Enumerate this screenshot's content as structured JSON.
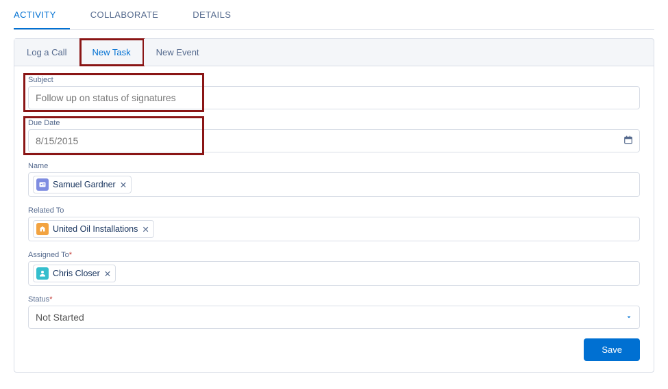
{
  "mainTabs": {
    "activity": "ACTIVITY",
    "collaborate": "COLLABORATE",
    "details": "DETAILS"
  },
  "subTabs": {
    "logACall": "Log a Call",
    "newTask": "New Task",
    "newEvent": "New Event"
  },
  "form": {
    "subject": {
      "label": "Subject",
      "value": "Follow up on status of signatures"
    },
    "dueDate": {
      "label": "Due Date",
      "value": "8/15/2015"
    },
    "name": {
      "label": "Name",
      "pill": "Samuel Gardner"
    },
    "relatedTo": {
      "label": "Related To",
      "pill": "United Oil Installations"
    },
    "assignedTo": {
      "label": "Assigned To",
      "pill": "Chris Closer"
    },
    "status": {
      "label": "Status",
      "value": "Not Started"
    }
  },
  "buttons": {
    "save": "Save"
  },
  "icons": {
    "close": "✕",
    "contact": "◎",
    "crown": "♛",
    "user": "👤"
  }
}
